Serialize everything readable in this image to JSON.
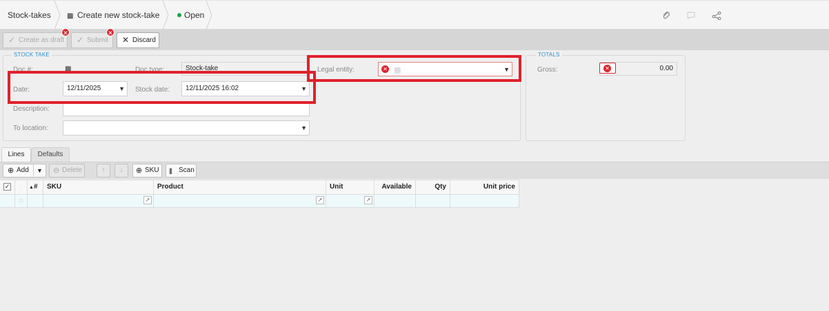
{
  "breadcrumb": {
    "root": "Stock-takes",
    "current": "Create new stock-take",
    "status": "Open"
  },
  "top_icons": [
    "paperclip-icon",
    "comment-icon",
    "share-icon"
  ],
  "toolbar": {
    "create_as_draft": "Create as draft",
    "submit": "Submit",
    "discard": "Discard"
  },
  "stock_take": {
    "legend": "STOCK TAKE",
    "doc_no_label": "Doc #:",
    "doc_type_label": "Doc type:",
    "doc_type_value": "Stock-take",
    "date_label": "Date:",
    "date_value": "12/11/2025",
    "stock_date_label": "Stock date:",
    "stock_date_value": "12/11/2025 16:02",
    "description_label": "Description:",
    "description_value": "",
    "to_location_label": "To location:",
    "to_location_value": "",
    "legal_entity_label": "Legal entity:",
    "legal_entity_value": ""
  },
  "totals": {
    "legend": "TOTALS",
    "gross_label": "Gross:",
    "gross_value": "0.00"
  },
  "tabs": [
    {
      "label": "Lines",
      "active": true
    },
    {
      "label": "Defaults",
      "active": false
    }
  ],
  "lines_toolbar": {
    "add": "Add",
    "delete": "Delete",
    "sku": "SKU",
    "scan": "Scan"
  },
  "grid": {
    "columns": [
      "#",
      "SKU",
      "Product",
      "Unit",
      "Available",
      "Qty",
      "Unit price"
    ]
  },
  "colors": {
    "accent": "#2a8fcf",
    "error": "#d9262f",
    "highlight": "#e0212b",
    "status": "#1aa34a"
  }
}
